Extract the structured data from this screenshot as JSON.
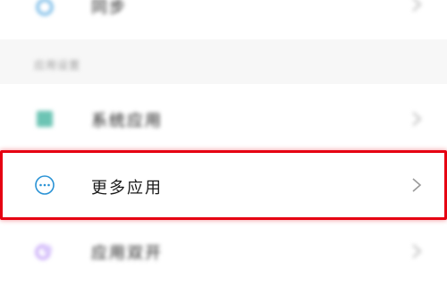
{
  "top_row": {
    "label": "同步",
    "icon": "sync-icon"
  },
  "section": {
    "title": "应用设置"
  },
  "rows": [
    {
      "label": "系统应用",
      "icon": "system-apps-icon"
    },
    {
      "label": "更多应用",
      "icon": "more-dots-icon"
    },
    {
      "label": "应用双开",
      "icon": "dual-apps-icon"
    }
  ],
  "colors": {
    "highlight": "#e60012",
    "accent_blue": "#2a93d5",
    "purple": "#b58bf5",
    "teal": "#4cb8a6"
  }
}
